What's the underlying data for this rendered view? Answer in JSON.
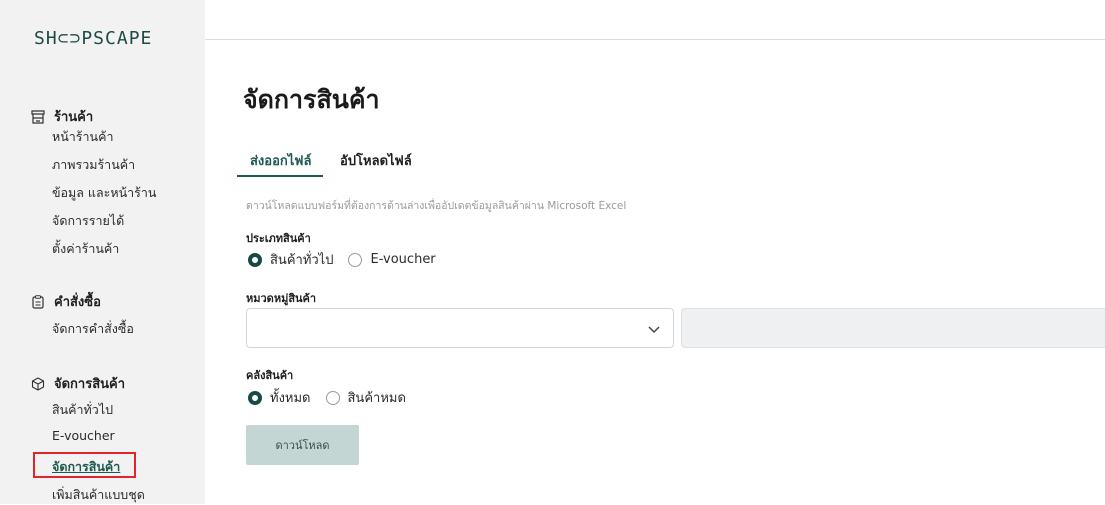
{
  "brand": {
    "logo_text": "SH⊂⊃PSCAPE"
  },
  "sidebar": {
    "sections": [
      {
        "title": "ร้านค้า",
        "icon": "store-icon",
        "items": [
          "หน้าร้านค้า",
          "ภาพรวมร้านค้า",
          "ข้อมูล และหน้าร้าน",
          "จัดการรายได้",
          "ตั้งค่าร้านค้า"
        ]
      },
      {
        "title": "คำสั่งซื้อ",
        "icon": "clipboard-icon",
        "items": [
          "จัดการคำสั่งซื้อ"
        ]
      },
      {
        "title": "จัดการสินค้า",
        "icon": "box-icon",
        "items": [
          "สินค้าทั่วไป",
          "E-voucher",
          "จัดการสินค้า",
          "เพิ่มสินค้าแบบชุด"
        ],
        "active_item": "จัดการสินค้า"
      }
    ]
  },
  "main": {
    "title": "จัดการสินค้า",
    "tabs": [
      {
        "label": "ส่งออกไฟล์",
        "active": true
      },
      {
        "label": "อัปโหลดไฟล์",
        "active": false
      }
    ],
    "description": "ดาวน์โหลดแบบฟอร์มที่ต้องการด้านล่างเพื่ออัปเดตข้อมูลสินค้าผ่าน Microsoft Excel",
    "product_type": {
      "label": "ประเภทสินค้า",
      "options": [
        "สินค้าทั่วไป",
        "E-voucher"
      ],
      "selected": "สินค้าทั่วไป"
    },
    "category": {
      "label": "หมวดหมู่สินค้า",
      "select_value": "",
      "secondary_value": ""
    },
    "warehouse": {
      "label": "คลังสินค้า",
      "options": [
        "ทั้งหมด",
        "สินค้าหมด"
      ],
      "selected": "ทั้งหมด"
    },
    "download_label": "ดาวน์โหลด"
  },
  "colors": {
    "accent": "#1d5a52",
    "highlight_frame": "#e0262c",
    "sidebar_bg": "#f1f2f1",
    "button_bg": "#c4d6d3"
  }
}
